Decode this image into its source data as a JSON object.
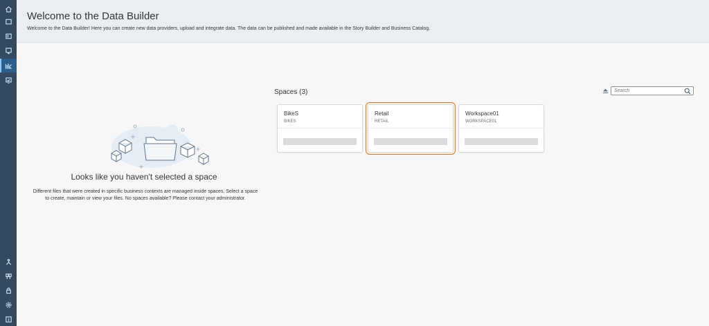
{
  "nav": {
    "top_items": [
      {
        "icon": "home-icon",
        "active": false
      },
      {
        "icon": "repository-icon",
        "active": false
      },
      {
        "icon": "catalog-icon",
        "active": false
      },
      {
        "icon": "story-icon",
        "active": false
      },
      {
        "icon": "data-builder-icon",
        "active": true
      },
      {
        "icon": "presentation-icon",
        "active": false
      }
    ],
    "bottom_items": [
      {
        "icon": "network-icon"
      },
      {
        "icon": "space-management-icon"
      },
      {
        "icon": "security-icon"
      },
      {
        "icon": "settings-icon"
      },
      {
        "icon": "info-icon"
      }
    ]
  },
  "header": {
    "title": "Welcome to the Data Builder",
    "subtitle": "Welcome to the Data Builder! Here you can create new data providers, upload and integrate data. The data can be published and made available in the Story Builder and Business Catalog."
  },
  "empty_state": {
    "title": "Looks like you haven't selected a space",
    "description": "Different files that were created in specific business contexts are managed inside spaces. Select a space to create, maintain or view your files. No spaces available? Please contact your administrator."
  },
  "spaces": {
    "title": "Spaces (3)",
    "search_placeholder": "Search",
    "items": [
      {
        "name": "BikeS",
        "technical_name": "BIKES",
        "selected": false
      },
      {
        "name": "Retail",
        "technical_name": "RETAIL",
        "selected": true
      },
      {
        "name": "Workspace01",
        "technical_name": "WORKSPACE01",
        "selected": false
      }
    ]
  },
  "colors": {
    "rail": "#354a5f",
    "rail_active": "#2b5e8c",
    "header_bg": "#eaeef3",
    "selected_outline": "#e9730c"
  }
}
